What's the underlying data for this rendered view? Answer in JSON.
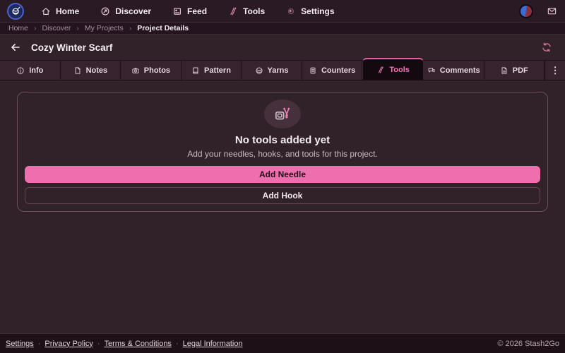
{
  "brand": {
    "name": "Stash2Go",
    "logo_icon": "yarn-ball"
  },
  "topnav": {
    "items": [
      {
        "label": "Home",
        "icon": "home"
      },
      {
        "label": "Discover",
        "icon": "compass-arrow"
      },
      {
        "label": "Feed",
        "icon": "feed-card"
      },
      {
        "label": "Tools",
        "icon": "knitting-needles"
      },
      {
        "label": "Settings",
        "icon": "gear-dot"
      }
    ],
    "right_icons": [
      "user-avatar",
      "mail-envelope"
    ]
  },
  "breadcrumb": {
    "separator": "›",
    "items": [
      "Home",
      "Discover",
      "My Projects",
      "Project Details"
    ]
  },
  "header": {
    "title": "Cozy Winter Scarf",
    "back_icon": "arrow-left",
    "refresh_icon": "sync-arrows"
  },
  "tabs": {
    "overflow": "⋮",
    "items": [
      {
        "label": "Info",
        "icon": "info-circle",
        "active": false
      },
      {
        "label": "Notes",
        "icon": "note-page",
        "active": false
      },
      {
        "label": "Photos",
        "icon": "camera",
        "active": false
      },
      {
        "label": "Pattern",
        "icon": "book",
        "active": false
      },
      {
        "label": "Yarns",
        "icon": "yarn-ball",
        "active": false
      },
      {
        "label": "Counters",
        "icon": "counter",
        "active": false
      },
      {
        "label": "Tools",
        "icon": "knitting-needles",
        "active": true
      },
      {
        "label": "Comments",
        "icon": "speech-bubbles",
        "active": false
      },
      {
        "label": "PDF",
        "icon": "pdf-page",
        "active": false
      }
    ]
  },
  "empty_state": {
    "icon": "tools-gauge-needles",
    "title": "No tools added yet",
    "subtitle": "Add your needles, hooks, and tools for this project.",
    "buttons": [
      {
        "label": "Add Needle",
        "variant": "primary"
      },
      {
        "label": "Add Hook",
        "variant": "outline"
      }
    ]
  },
  "footer": {
    "separator": "·",
    "links": [
      "Settings",
      "Privacy Policy",
      "Terms & Conditions",
      "Legal Information"
    ],
    "copyright": "© 2026 Stash2Go"
  },
  "colors": {
    "accent_pink": "#ee6fad",
    "page_bg": "#302228",
    "nav_bg": "#2a1a24",
    "active_tab_bg": "#130a10",
    "card_border": "#6f4c5e",
    "footer_bg": "#1d1017"
  }
}
